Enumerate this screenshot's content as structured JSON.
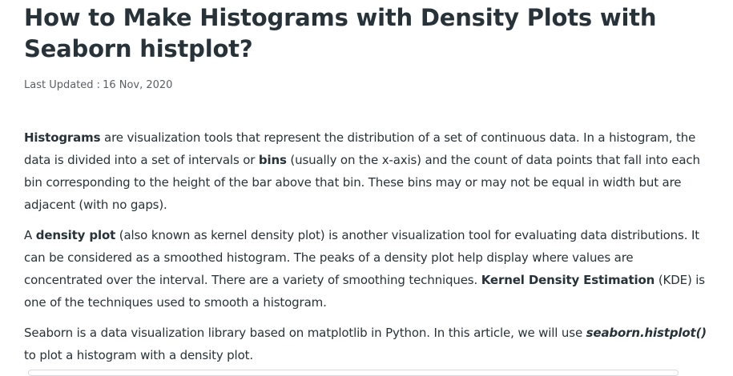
{
  "article": {
    "title": "How to Make Histograms with Density Plots with Seaborn histplot?",
    "last_updated_label": "Last Updated :",
    "last_updated_date": "16 Nov, 2020",
    "p1": {
      "b1": "Histograms",
      "t1": " are visualization tools that represent the distribution of a set of continuous data. In a histogram, the data is divided into a set of intervals or ",
      "b2": "bins",
      "t2": " (usually on the x-axis) and the count of data points that fall into each bin corresponding to the height of the bar above that bin. These bins may or may not be equal in width but are adjacent (with no gaps)."
    },
    "p2": {
      "t1": "A ",
      "b1": "density plot",
      "t2": " (also known as kernel density plot) is another visualization tool for evaluating data distributions. It can be considered as a smoothed histogram. The peaks of a density plot help display where values are concentrated over the interval. There are a variety of smoothing techniques. ",
      "b2": "Kernel Density Estimation",
      "t3": " (KDE) is one of the techniques used to smooth a histogram."
    },
    "p3": {
      "t1": "Seaborn is a data visualization library based on matplotlib in Python. In this article, we will use ",
      "code": "seaborn.histplot()",
      "t2": " to plot a histogram with a density plot."
    }
  }
}
